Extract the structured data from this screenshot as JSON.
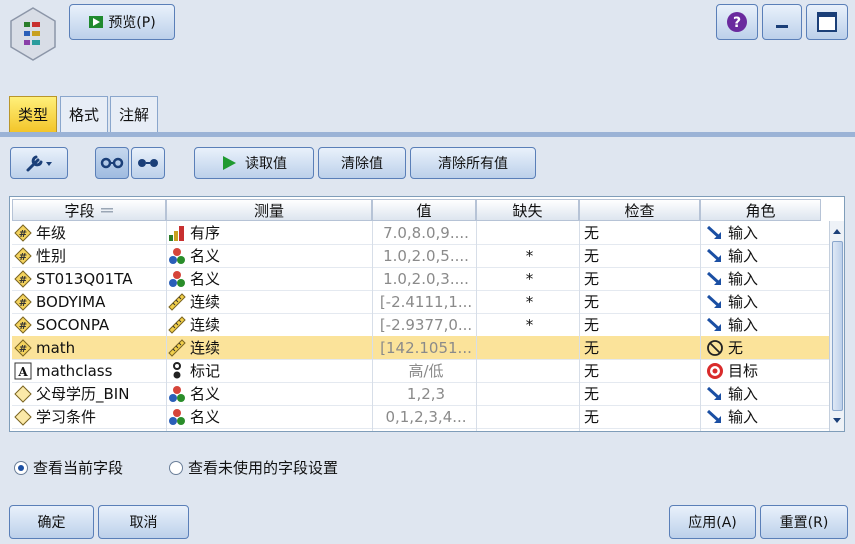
{
  "top": {
    "preview_label": "预览(P)"
  },
  "tabs": [
    {
      "label": "类型",
      "active": true
    },
    {
      "label": "格式"
    },
    {
      "label": "注解"
    }
  ],
  "toolbar": {
    "read_values": "读取值",
    "clear_values": "清除值",
    "clear_all_values": "清除所有值"
  },
  "table": {
    "headers": [
      "字段",
      "测量",
      "值",
      "缺失",
      "检查",
      "角色"
    ],
    "rows": [
      {
        "field": "年级",
        "field_icon": "numeric-field-icon",
        "measure": "有序",
        "measure_icon": "ordinal-icon",
        "values": "7.0,8.0,9....",
        "missing": "",
        "check": "无",
        "role": "输入",
        "role_icon": "input-arrow-icon"
      },
      {
        "field": "性别",
        "field_icon": "numeric-field-icon",
        "measure": "名义",
        "measure_icon": "nominal-icon",
        "values": "1.0,2.0,5....",
        "missing": "*",
        "check": "无",
        "role": "输入",
        "role_icon": "input-arrow-icon"
      },
      {
        "field": "ST013Q01TA",
        "field_icon": "numeric-field-icon",
        "measure": "名义",
        "measure_icon": "nominal-icon",
        "values": "1.0,2.0,3....",
        "missing": "*",
        "check": "无",
        "role": "输入",
        "role_icon": "input-arrow-icon"
      },
      {
        "field": "BODYIMA",
        "field_icon": "numeric-field-icon",
        "measure": "连续",
        "measure_icon": "continuous-ruler-icon",
        "values": "[-2.4111,1...",
        "missing": "*",
        "check": "无",
        "role": "输入",
        "role_icon": "input-arrow-icon"
      },
      {
        "field": "SOCONPA",
        "field_icon": "numeric-field-icon",
        "measure": "连续",
        "measure_icon": "continuous-ruler-icon",
        "values": "[-2.9377,0...",
        "missing": "*",
        "check": "无",
        "role": "输入",
        "role_icon": "input-arrow-icon"
      },
      {
        "field": "math",
        "field_icon": "numeric-field-icon",
        "measure": "连续",
        "measure_icon": "continuous-ruler-icon",
        "values": "[142.1051...",
        "missing": "",
        "check": "无",
        "role": "无",
        "role_icon": "none-role-icon",
        "selected": true
      },
      {
        "field": "mathclass",
        "field_icon": "string-field-icon",
        "measure": "标记",
        "measure_icon": "flag-icon",
        "values": "高/低",
        "missing": "",
        "check": "无",
        "role": "目标",
        "role_icon": "target-icon"
      },
      {
        "field": "父母学历_BIN",
        "field_icon": "derived-field-icon",
        "measure": "名义",
        "measure_icon": "nominal-icon",
        "values": "1,2,3",
        "missing": "",
        "check": "无",
        "role": "输入",
        "role_icon": "input-arrow-icon"
      },
      {
        "field": "学习条件",
        "field_icon": "derived-field-icon",
        "measure": "名义",
        "measure_icon": "nominal-icon",
        "values": "0,1,2,3,4...",
        "missing": "",
        "check": "无",
        "role": "输入",
        "role_icon": "input-arrow-icon"
      }
    ]
  },
  "options": {
    "view_current": "查看当前字段",
    "view_unused": "查看未使用的字段设置"
  },
  "footer": {
    "ok": "确定",
    "cancel": "取消",
    "apply": "应用(A)",
    "reset": "重置(R)"
  }
}
